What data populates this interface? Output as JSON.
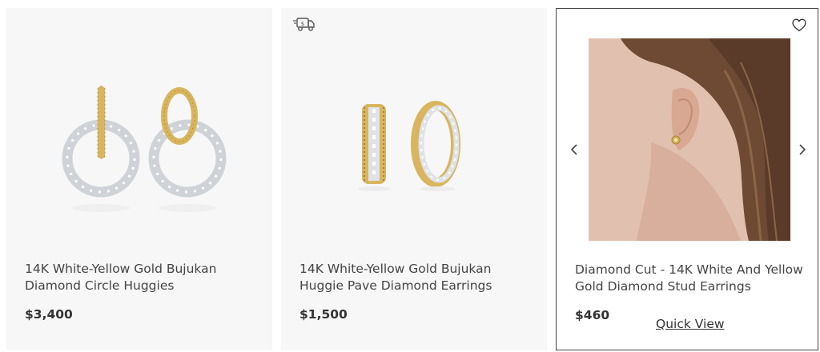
{
  "products": [
    {
      "title": "14K White-Yellow Gold Bujukan Diamond Circle Huggies",
      "price": "$3,400"
    },
    {
      "title": "14K White-Yellow Gold Bujukan Huggie Pave Diamond Earrings",
      "price": "$1,500"
    },
    {
      "title": "Diamond Cut - 14K White And Yellow Gold Diamond Stud Earrings",
      "price": "$460",
      "quick_view": "Quick View"
    }
  ],
  "icons": {
    "shipping": "delivery-truck-icon",
    "wishlist": "heart-icon",
    "prev": "chevron-left-icon",
    "next": "chevron-right-icon"
  },
  "colors": {
    "card_bg": "#f7f7f7",
    "gold": "#d4b15a",
    "diamond": "#d9dde2",
    "text": "#333333"
  }
}
